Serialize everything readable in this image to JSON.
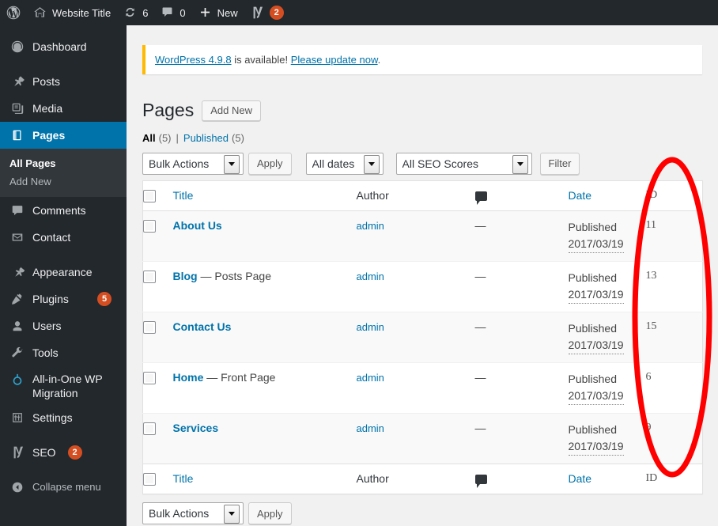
{
  "adminbar": {
    "wp_logo": "wordpress-logo",
    "site_name": "Website Title",
    "updates_count": "6",
    "comments_count": "0",
    "new_label": "New",
    "seo_badge": "2"
  },
  "sidebar": {
    "items": [
      {
        "label": "Dashboard",
        "icon": "dashboard-icon"
      },
      {
        "label": "Posts",
        "icon": "posts-pin-icon"
      },
      {
        "label": "Media",
        "icon": "media-icon"
      },
      {
        "label": "Pages",
        "icon": "pages-icon",
        "current": true
      },
      {
        "label": "Comments",
        "icon": "comments-icon"
      },
      {
        "label": "Contact",
        "icon": "contact-mail-icon"
      },
      {
        "label": "Appearance",
        "icon": "appearance-brush-icon"
      },
      {
        "label": "Plugins",
        "icon": "plugins-plug-icon",
        "badge": "5"
      },
      {
        "label": "Users",
        "icon": "users-icon"
      },
      {
        "label": "Tools",
        "icon": "tools-wrench-icon"
      },
      {
        "label": "All-in-One WP Migration",
        "icon": "migration-icon"
      },
      {
        "label": "Settings",
        "icon": "settings-sliders-icon"
      },
      {
        "label": "SEO",
        "icon": "yoast-seo-icon",
        "badge": "2"
      }
    ],
    "submenu": [
      {
        "label": "All Pages",
        "current": true
      },
      {
        "label": "Add New",
        "current": false
      }
    ],
    "collapse_label": "Collapse menu"
  },
  "notice": {
    "link_version": "WordPress 4.9.8",
    "middle_text": " is available! ",
    "link_update": "Please update now",
    "end_text": "."
  },
  "page": {
    "title": "Pages",
    "add_new_label": "Add New"
  },
  "filters": {
    "all_label": "All",
    "all_count": "(5)",
    "separator": "|",
    "published_label": "Published",
    "published_count": "(5)"
  },
  "toolbar": {
    "bulk_actions_label": "Bulk Actions",
    "apply_label": "Apply",
    "dates_label": "All dates",
    "seo_scores_label": "All SEO Scores",
    "filter_label": "Filter"
  },
  "table": {
    "columns": {
      "title": "Title",
      "author": "Author",
      "comments": "comments-bubble-icon",
      "date": "Date",
      "id": "ID"
    },
    "rows": [
      {
        "title": "About Us",
        "suffix": "",
        "author": "admin",
        "comments": "—",
        "status": "Published",
        "date": "2017/03/19",
        "id": "11"
      },
      {
        "title": "Blog",
        "suffix": " — Posts Page",
        "author": "admin",
        "comments": "—",
        "status": "Published",
        "date": "2017/03/19",
        "id": "13"
      },
      {
        "title": "Contact Us",
        "suffix": "",
        "author": "admin",
        "comments": "—",
        "status": "Published",
        "date": "2017/03/19",
        "id": "15"
      },
      {
        "title": "Home",
        "suffix": " — Front Page",
        "author": "admin",
        "comments": "—",
        "status": "Published",
        "date": "2017/03/19",
        "id": "6"
      },
      {
        "title": "Services",
        "suffix": "",
        "author": "admin",
        "comments": "—",
        "status": "Published",
        "date": "2017/03/19",
        "id": "9"
      }
    ]
  },
  "bottom_toolbar": {
    "bulk_actions_label": "Bulk Actions",
    "apply_label": "Apply"
  },
  "annotation": {
    "shape": "ellipse",
    "color": "#ff0000",
    "target": "id-column"
  },
  "colors": {
    "admin_blue": "#0073aa",
    "sidebar_bg": "#23282d",
    "badge_orange": "#d54e21",
    "notice_border": "#ffb900",
    "annotation_red": "#ff0000"
  }
}
